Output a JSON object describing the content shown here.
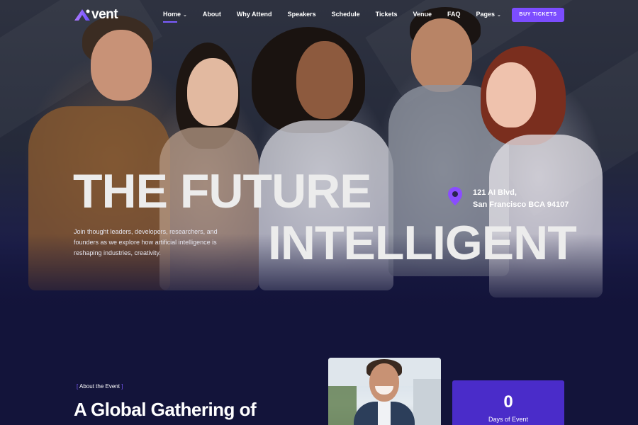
{
  "brand": {
    "logo_letter": "A",
    "logo_text": "vent",
    "accent": "#7c4dff"
  },
  "nav": {
    "items": [
      {
        "label": "Home",
        "has_caret": true,
        "active": true
      },
      {
        "label": "About"
      },
      {
        "label": "Why Attend"
      },
      {
        "label": "Speakers"
      },
      {
        "label": "Schedule"
      },
      {
        "label": "Tickets"
      },
      {
        "label": "Venue"
      },
      {
        "label": "FAQ"
      },
      {
        "label": "Pages",
        "has_caret": true
      }
    ],
    "cta": "BUY TICKETS"
  },
  "hero": {
    "headline_line1": "THE FUTURE",
    "headline_line2": "INTELLIGENT",
    "description": "Join thought leaders, developers, researchers, and founders as we explore how artificial intelligence is reshaping industries, creativity.",
    "location_line1": "121 AI Blvd,",
    "location_line2": "San Francisco BCA 94107",
    "location_icon": "map-pin-icon"
  },
  "about": {
    "tag": "About the Event",
    "title": "A Global Gathering of"
  },
  "counter": {
    "value": "0",
    "label": "Days of Event"
  }
}
